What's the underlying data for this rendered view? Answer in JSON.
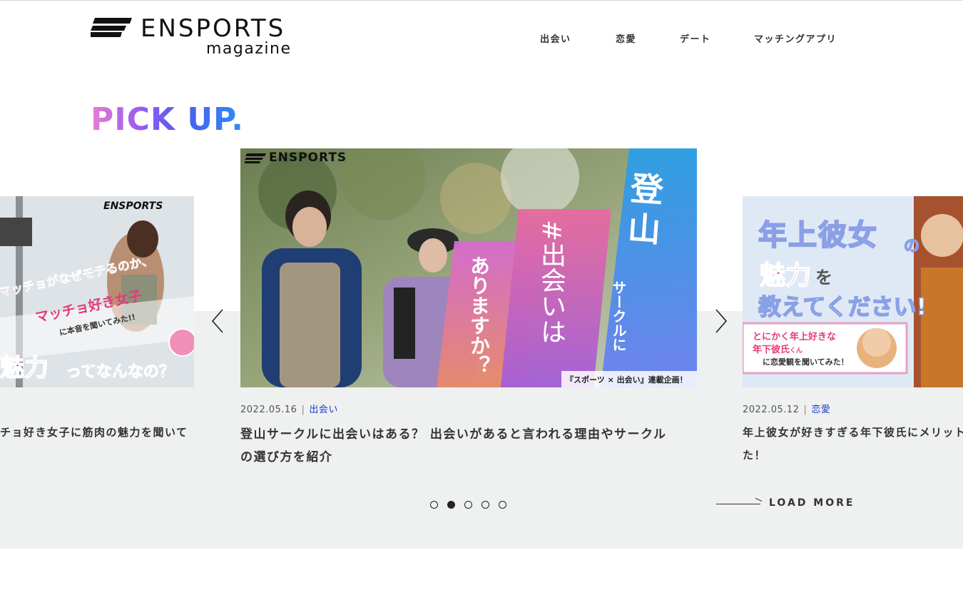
{
  "header": {
    "logo_word": "ENSPORTS",
    "logo_sub": "magazine",
    "nav": [
      {
        "label": "出会い"
      },
      {
        "label": "恋愛"
      },
      {
        "label": "デート"
      },
      {
        "label": "マッチングアプリ"
      }
    ]
  },
  "pickup": {
    "heading": "PICK UP."
  },
  "slides": [
    {
      "title": "チョ好き女子に筋肉の魅力を聞いて",
      "image": {
        "brand": "ENSPORTS",
        "line1": "マッチョがなぜモテるのか、",
        "line2": "マッチョ好き女子",
        "line3": "に本音を聞いてみた!!",
        "line4": "魅力",
        "line5": "ってなんなの？"
      }
    },
    {
      "date": "2022.05.16",
      "category": "出会い",
      "title_line1": "登山サークルに出会いはある？ 出会いがあると言われる理由やサークル",
      "title_line2": "の選び方を紹介",
      "image": {
        "brand": "ENSPORTS",
        "big1": "登山",
        "sub1": "サークルに",
        "big2": "#出会いは",
        "big3": "ありますか？",
        "footer": "『スポーツ × 出会い』連載企画！"
      }
    },
    {
      "date": "2022.05.12",
      "category": "恋愛",
      "title_line1": "年上彼女が好きすぎる年下彼氏にメリット",
      "title_line2": "た！",
      "image": {
        "line1": "年上彼女",
        "line1b": "の",
        "line2": "魅力",
        "line2b": "を",
        "line3": "教えてください!",
        "box1": "とにかく年上好きな",
        "box2": "年下彼氏",
        "box2b": "くん",
        "box3": "に恋愛観を聞いてみた！"
      }
    }
  ],
  "pagination": {
    "count": 5,
    "active": 2
  },
  "load_more": "LOAD MORE",
  "colors": {
    "category": "#1a3fd0",
    "section_bg": "#eff0f0"
  }
}
